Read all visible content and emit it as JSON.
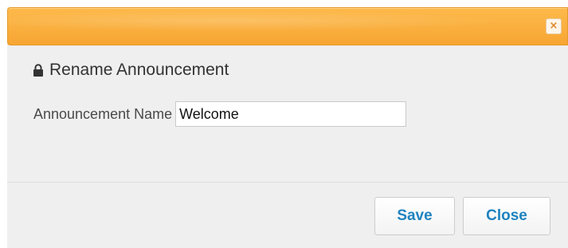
{
  "dialog": {
    "title": "Rename Announcement",
    "title_icon": "lock-icon",
    "close_icon": "close-icon",
    "close_glyph": "×",
    "colors": {
      "titlebar": "#f9ad3d",
      "background": "#efefef",
      "button_text": "#1f83bf"
    }
  },
  "form": {
    "name_label": "Announcement Name",
    "name_value": "Welcome"
  },
  "footer": {
    "save_label": "Save",
    "close_label": "Close"
  }
}
